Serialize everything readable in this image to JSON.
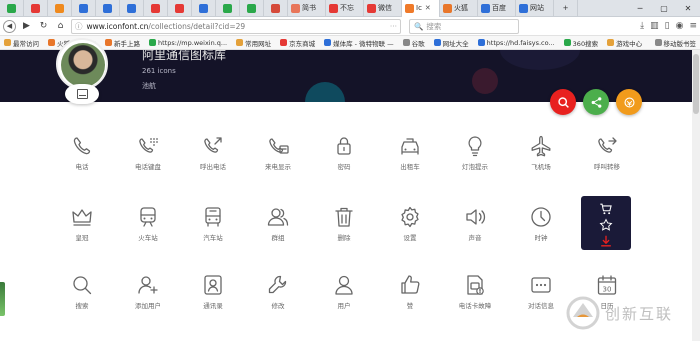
{
  "browser": {
    "tabs": [
      {
        "label": "",
        "color": "#2aa84a"
      },
      {
        "label": "",
        "color": "#e53935"
      },
      {
        "label": "",
        "color": "#ef8a1e"
      },
      {
        "label": "",
        "color": "#2e6fd8"
      },
      {
        "label": "",
        "color": "#2e6fd8"
      },
      {
        "label": "",
        "color": "#2e6fd8"
      },
      {
        "label": "",
        "color": "#e53935"
      },
      {
        "label": "",
        "color": "#e53935"
      },
      {
        "label": "",
        "color": "#2e6fd8"
      },
      {
        "label": "",
        "color": "#2aa84a"
      },
      {
        "label": "",
        "color": "#2aa84a"
      },
      {
        "label": "",
        "color": "#d54a3a"
      },
      {
        "label": "简书",
        "color": "#e8765a"
      },
      {
        "label": "不忘",
        "color": "#e53935"
      },
      {
        "label": "微信",
        "color": "#e53935"
      },
      {
        "label": "Ic",
        "color": "#ef7a2a",
        "active": true
      },
      {
        "label": "火狐",
        "color": "#e8762a"
      },
      {
        "label": "百度",
        "color": "#2e6fd8"
      },
      {
        "label": "网站",
        "color": "#2e6fd8"
      }
    ],
    "url_host": "www.iconfont.cn",
    "url_path": "/collections/detail?cid=29",
    "search_placeholder": "搜索",
    "bookmarks": [
      {
        "label": "最常访问",
        "color": "#e4a13a"
      },
      {
        "label": "火狐官方站点",
        "color": "#e8762a"
      },
      {
        "label": "新手上路",
        "color": "#e8762a"
      },
      {
        "label": "https://mp.weixin.q...",
        "color": "#2aa84a"
      },
      {
        "label": "常用网址",
        "color": "#e4a13a"
      },
      {
        "label": "京东商城",
        "color": "#e53935"
      },
      {
        "label": "媒体库 - 微特物联 —",
        "color": "#2e6fd8"
      },
      {
        "label": "谷歌",
        "color": "#888888"
      },
      {
        "label": "网址大全",
        "color": "#2e6fd8"
      },
      {
        "label": "https://hd.faisys.co...",
        "color": "#2e6fd8"
      },
      {
        "label": "360搜索",
        "color": "#2aa84a"
      },
      {
        "label": "游戏中心",
        "color": "#e4a13a"
      }
    ],
    "bookmarks_right": "移动版书签"
  },
  "collection": {
    "title": "阿里通信图标库",
    "count": "261 icons",
    "author": "池航"
  },
  "accent_colors": {
    "search_fab": "#e8211f",
    "share_fab": "#4cae4c",
    "collect_fab": "#f19b1c",
    "download": "#e8211f"
  },
  "icons_row1": [
    {
      "icon": "phone-icon",
      "label": "电话"
    },
    {
      "icon": "phone-keypad-icon",
      "label": "电话键盘"
    },
    {
      "icon": "phone-outgoing-icon",
      "label": "呼出电话"
    },
    {
      "icon": "caller-id-icon",
      "label": "来电显示"
    },
    {
      "icon": "lock-icon",
      "label": "密码"
    },
    {
      "icon": "taxi-icon",
      "label": "出租车"
    },
    {
      "icon": "lightbulb-icon",
      "label": "灯泡提示"
    },
    {
      "icon": "airplane-icon",
      "label": "飞机场"
    },
    {
      "icon": "call-forward-icon",
      "label": "呼叫转移"
    }
  ],
  "icons_row2": [
    {
      "icon": "crown-icon",
      "label": "皇冠"
    },
    {
      "icon": "train-icon",
      "label": "火车站"
    },
    {
      "icon": "bus-icon",
      "label": "汽车站"
    },
    {
      "icon": "group-icon",
      "label": "群组"
    },
    {
      "icon": "trash-icon",
      "label": "删除"
    },
    {
      "icon": "settings-icon",
      "label": "设置"
    },
    {
      "icon": "volume-icon",
      "label": "声音"
    },
    {
      "icon": "clock-icon",
      "label": "时钟"
    }
  ],
  "icons_row3": [
    {
      "icon": "search-icon",
      "label": "搜索"
    },
    {
      "icon": "add-user-icon",
      "label": "添加用户"
    },
    {
      "icon": "contacts-icon",
      "label": "通讯录"
    },
    {
      "icon": "wrench-icon",
      "label": "修改"
    },
    {
      "icon": "user-icon",
      "label": "用户"
    },
    {
      "icon": "thumbs-up-icon",
      "label": "赞"
    },
    {
      "icon": "phone-card-error-icon",
      "label": "电话卡故障"
    },
    {
      "icon": "chat-message-icon",
      "label": "对话信息"
    },
    {
      "icon": "calendar-icon",
      "label": "日历"
    }
  ],
  "calendar_number": "30",
  "watermark_text": "创新互联"
}
